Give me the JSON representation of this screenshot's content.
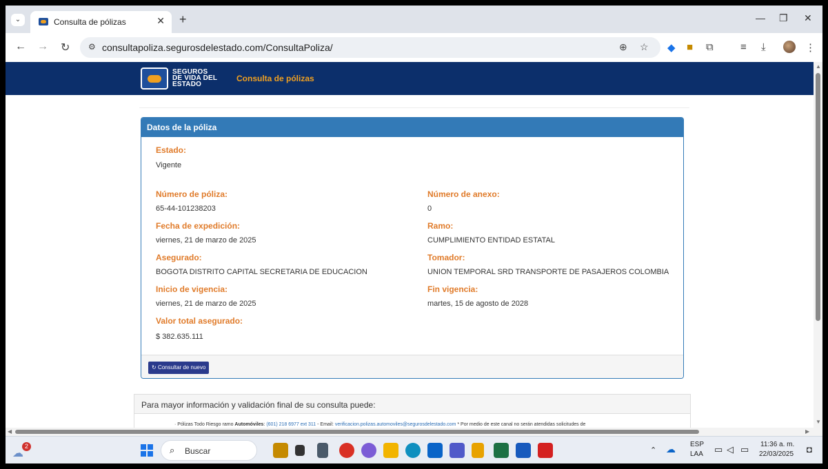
{
  "browser": {
    "tab_title": "Consulta de pólizas",
    "tab_close": "✕",
    "new_tab": "+",
    "url": "consultapoliza.segurosdelestado.com/ConsultaPoliza/"
  },
  "site": {
    "logo_line1": "SEGUROS",
    "logo_line2": "DE VIDA DEL",
    "logo_line3": "ESTADO",
    "header_link": "Consulta de pólizas"
  },
  "panel": {
    "title": "Datos de la póliza",
    "estado_label": "Estado:",
    "estado_value": "Vigente",
    "numero_poliza_label": "Número de póliza:",
    "numero_poliza_value": "65-44-101238203",
    "numero_anexo_label": "Número de anexo:",
    "numero_anexo_value": "0",
    "fecha_expedicion_label": "Fecha de expedición:",
    "fecha_expedicion_value": "viernes, 21 de marzo de 2025",
    "ramo_label": "Ramo:",
    "ramo_value": "CUMPLIMIENTO ENTIDAD ESTATAL",
    "asegurado_label": "Asegurado:",
    "asegurado_value": "BOGOTA DISTRITO CAPITAL SECRETARIA DE EDUCACION",
    "tomador_label": "Tomador:",
    "tomador_value": "UNION TEMPORAL SRD TRANSPORTE DE PASAJEROS COLOMBIA",
    "inicio_label": "Inicio de vigencia:",
    "inicio_value": "viernes, 21 de marzo de 2025",
    "fin_label": "Fin vigencia:",
    "fin_value": "martes, 15 de agosto de 2028",
    "valor_label": "Valor total asegurado:",
    "valor_value": "$ 382.635.111",
    "button_label": "Consultar de nuevo"
  },
  "info": {
    "heading": "Para mayor información y validación final de su consulta puede:",
    "line_prefix": "· Pólizas Todo Riesgo ramo ",
    "line_bold": "Automóviles",
    "line_phone": "(601) 218 6977 ext 311",
    "line_email_label": " - Email: ",
    "line_email": "verificacion.polizas.automoviles@segurosdelestado.com",
    "line_suffix": " * Por medio de este canal no serán atendidas solicitudes de"
  },
  "taskbar": {
    "weather_badge": "2",
    "search_placeholder": "Buscar",
    "lang_top": "ESP",
    "lang_bottom": "LAA",
    "time": "11:36 a. m.",
    "date": "22/03/2025"
  },
  "colors": {
    "site_header": "#0c2f6b",
    "panel_header": "#337ab7",
    "label_orange": "#e07b2a",
    "button": "#2a3a8c"
  }
}
